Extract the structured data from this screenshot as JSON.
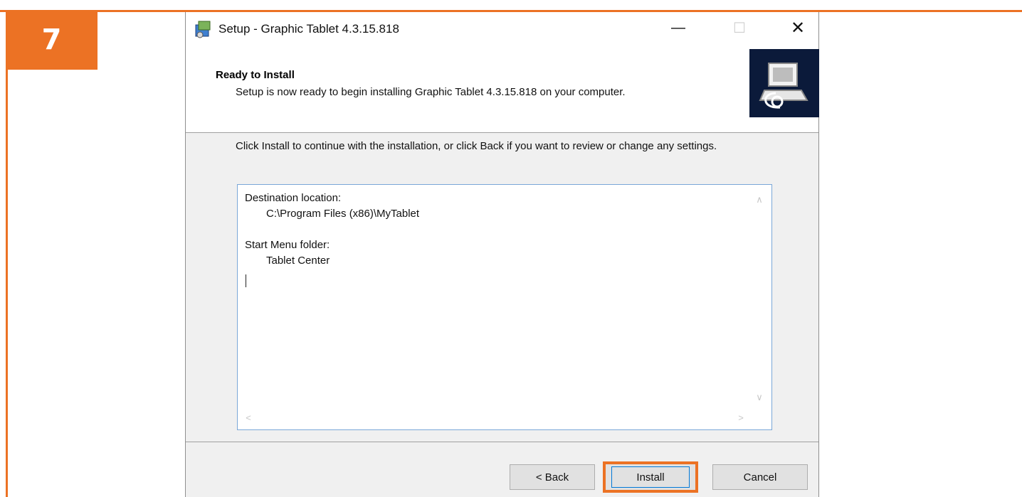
{
  "step": {
    "number": "7"
  },
  "window": {
    "title": "Setup - Graphic Tablet 4.3.15.818",
    "controls": {
      "minimize": "—",
      "maximize": "☐",
      "close": "✕"
    }
  },
  "header": {
    "title": "Ready to Install",
    "subtitle": "Setup is now ready to begin installing Graphic Tablet 4.3.15.818 on your computer."
  },
  "instruction": "Click Install to continue with the installation, or click Back if you want to review or change any settings.",
  "memo": {
    "destination_label": "Destination location:",
    "destination_value": "C:\\Program Files (x86)\\MyTablet",
    "start_menu_label": "Start Menu folder:",
    "start_menu_value": "Tablet Center"
  },
  "buttons": {
    "back": "< Back",
    "install": "Install",
    "cancel": "Cancel"
  },
  "colors": {
    "accent": "#ec7224",
    "focus": "#0078d7"
  }
}
